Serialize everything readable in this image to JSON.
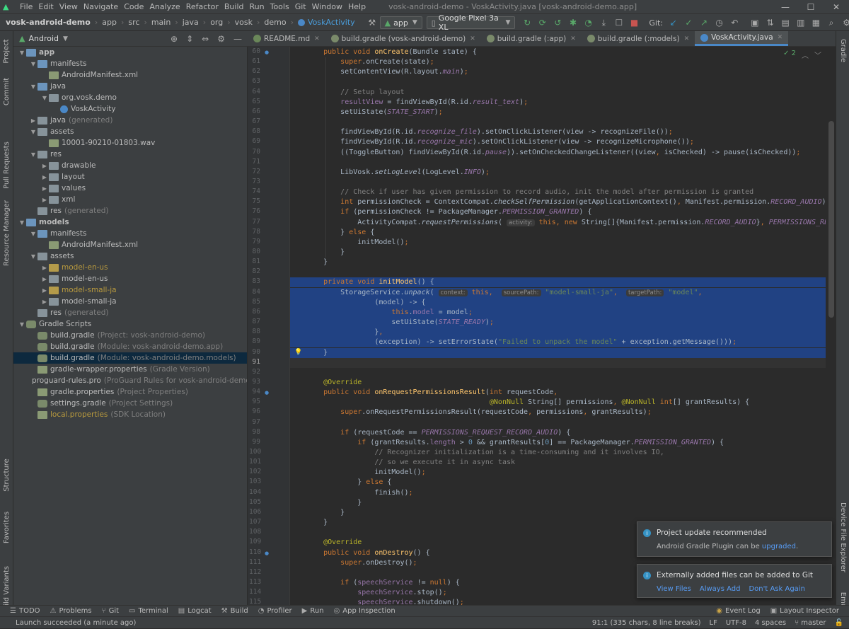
{
  "window": {
    "title": "vosk-android-demo - VoskActivity.java [vosk-android-demo.app]"
  },
  "menu": [
    "File",
    "Edit",
    "View",
    "Navigate",
    "Code",
    "Analyze",
    "Refactor",
    "Build",
    "Run",
    "Tools",
    "Git",
    "Window",
    "Help"
  ],
  "breadcrumb": [
    "vosk-android-demo",
    "app",
    "src",
    "main",
    "java",
    "org",
    "vosk",
    "demo",
    "VoskActivity"
  ],
  "toolbar": {
    "config": "app",
    "device": "Google Pixel 3a XL",
    "git_label": "Git:"
  },
  "project_panel": {
    "view": "Android"
  },
  "tree": [
    {
      "d": 0,
      "a": "▼",
      "icon": "folder-blue",
      "label": "app",
      "sub": ""
    },
    {
      "d": 1,
      "a": "▼",
      "icon": "folder-blue",
      "label": "manifests",
      "sub": ""
    },
    {
      "d": 2,
      "a": "",
      "icon": "file",
      "label": "AndroidManifest.xml",
      "sub": ""
    },
    {
      "d": 1,
      "a": "▼",
      "icon": "folder-blue",
      "label": "java",
      "sub": ""
    },
    {
      "d": 2,
      "a": "▼",
      "icon": "folder",
      "label": "org.vosk.demo",
      "sub": ""
    },
    {
      "d": 3,
      "a": "",
      "icon": "class",
      "label": "VoskActivity",
      "sub": ""
    },
    {
      "d": 1,
      "a": "▶",
      "icon": "folder",
      "label": "java",
      "sub": "(generated)"
    },
    {
      "d": 1,
      "a": "▼",
      "icon": "folder",
      "label": "assets",
      "sub": ""
    },
    {
      "d": 2,
      "a": "",
      "icon": "file",
      "label": "10001-90210-01803.wav",
      "sub": ""
    },
    {
      "d": 1,
      "a": "▼",
      "icon": "folder",
      "label": "res",
      "sub": ""
    },
    {
      "d": 2,
      "a": "▶",
      "icon": "folder",
      "label": "drawable",
      "sub": ""
    },
    {
      "d": 2,
      "a": "▶",
      "icon": "folder",
      "label": "layout",
      "sub": ""
    },
    {
      "d": 2,
      "a": "▶",
      "icon": "folder",
      "label": "values",
      "sub": ""
    },
    {
      "d": 2,
      "a": "▶",
      "icon": "folder",
      "label": "xml",
      "sub": ""
    },
    {
      "d": 1,
      "a": "",
      "icon": "folder",
      "label": "res",
      "sub": "(generated)"
    },
    {
      "d": 0,
      "a": "▼",
      "icon": "folder-blue",
      "label": "models",
      "sub": ""
    },
    {
      "d": 1,
      "a": "▼",
      "icon": "folder-blue",
      "label": "manifests",
      "sub": ""
    },
    {
      "d": 2,
      "a": "",
      "icon": "file",
      "label": "AndroidManifest.xml",
      "sub": ""
    },
    {
      "d": 1,
      "a": "▼",
      "icon": "folder",
      "label": "assets",
      "sub": ""
    },
    {
      "d": 2,
      "a": "▶",
      "icon": "folder-gold",
      "label": "model-en-us",
      "sub": "",
      "gold": true
    },
    {
      "d": 2,
      "a": "▶",
      "icon": "folder",
      "label": "model-en-us",
      "sub": ""
    },
    {
      "d": 2,
      "a": "▶",
      "icon": "folder-gold",
      "label": "model-small-ja",
      "sub": "",
      "gold": true
    },
    {
      "d": 2,
      "a": "▶",
      "icon": "folder",
      "label": "model-small-ja",
      "sub": ""
    },
    {
      "d": 1,
      "a": "",
      "icon": "folder",
      "label": "res",
      "sub": "(generated)"
    },
    {
      "d": 0,
      "a": "▼",
      "icon": "gradle",
      "label": "Gradle Scripts",
      "sub": ""
    },
    {
      "d": 1,
      "a": "",
      "icon": "gradle",
      "label": "build.gradle",
      "sub": "(Project: vosk-android-demo)"
    },
    {
      "d": 1,
      "a": "",
      "icon": "gradle",
      "label": "build.gradle",
      "sub": "(Module: vosk-android-demo.app)"
    },
    {
      "d": 1,
      "a": "",
      "icon": "gradle",
      "label": "build.gradle",
      "sub": "(Module: vosk-android-demo.models)",
      "sel": true
    },
    {
      "d": 1,
      "a": "",
      "icon": "file",
      "label": "gradle-wrapper.properties",
      "sub": "(Gradle Version)"
    },
    {
      "d": 1,
      "a": "",
      "icon": "file",
      "label": "proguard-rules.pro",
      "sub": "(ProGuard Rules for vosk-android-demo.app)"
    },
    {
      "d": 1,
      "a": "",
      "icon": "file",
      "label": "gradle.properties",
      "sub": "(Project Properties)"
    },
    {
      "d": 1,
      "a": "",
      "icon": "gradle",
      "label": "settings.gradle",
      "sub": "(Project Settings)"
    },
    {
      "d": 1,
      "a": "",
      "icon": "file",
      "label": "local.properties",
      "sub": "(SDK Location)",
      "gold": true
    }
  ],
  "tabs": [
    {
      "label": "README.md",
      "icon": "#6a8759",
      "active": false
    },
    {
      "label": "build.gradle (vosk-android-demo)",
      "icon": "#7a8a6a",
      "active": false
    },
    {
      "label": "build.gradle (:app)",
      "icon": "#7a8a6a",
      "active": false
    },
    {
      "label": "build.gradle (:models)",
      "icon": "#7a8a6a",
      "active": false
    },
    {
      "label": "VoskActivity.java",
      "icon": "#4a88c7",
      "active": true
    }
  ],
  "editor": {
    "inspections": "✓ 2"
  },
  "code": [
    {
      "n": "60",
      "h": "    <span class='k'>public void </span><span class='f'>onCreate</span>(Bundle state) {"
    },
    {
      "n": "61",
      "h": "        <span class='k'>super</span>.onCreate(state)<span class='k'>;</span>"
    },
    {
      "n": "62",
      "h": "        setContentView(R.layout.<span class='p'>main</span>)<span class='k'>;</span>"
    },
    {
      "n": "63",
      "h": ""
    },
    {
      "n": "64",
      "h": "        <span class='c'>// Setup layout</span>"
    },
    {
      "n": "65",
      "h": "        <span class='pf'>resultView</span> = findViewById(R.id.<span class='p'>result_text</span>)<span class='k'>;</span>"
    },
    {
      "n": "66",
      "h": "        setUiState(<span class='p'>STATE_START</span>)<span class='k'>;</span>"
    },
    {
      "n": "67",
      "h": ""
    },
    {
      "n": "68",
      "h": "        findViewById(R.id.<span class='p'>recognize_file</span>).setOnClickListener(view -> recognizeFile())<span class='k'>;</span>"
    },
    {
      "n": "69",
      "h": "        findViewById(R.id.<span class='p'>recognize_mic</span>).setOnClickListener(view -> recognizeMicrophone())<span class='k'>;</span>"
    },
    {
      "n": "70",
      "h": "        ((ToggleButton) findViewById(R.id.<span class='p'>pause</span>)).setOnCheckedChangeListener((view<span class='k'>, </span>isChecked) -> pause(isChecked))<span class='k'>;</span>"
    },
    {
      "n": "71",
      "h": ""
    },
    {
      "n": "72",
      "h": "        LibVosk.<span class='it'>setLogLevel</span>(LogLevel.<span class='p'>INFO</span>)<span class='k'>;</span>"
    },
    {
      "n": "73",
      "h": ""
    },
    {
      "n": "74",
      "h": "        <span class='c'>// Check if user has given permission to record audio, init the model after permission is granted</span>"
    },
    {
      "n": "75",
      "h": "        <span class='k'>int </span>permissionCheck = ContextCompat.<span class='it'>checkSelfPermission</span>(getApplicationContext()<span class='k'>, </span>Manifest.permission.<span class='p'>RECORD_AUDIO</span>)<span class='k'>;</span>"
    },
    {
      "n": "76",
      "h": "        <span class='k'>if </span>(permissionCheck != PackageManager.<span class='p'>PERMISSION_GRANTED</span>) {"
    },
    {
      "n": "77",
      "h": "            ActivityCompat.<span class='it'>requestPermissions</span>( <span class='hint'>activity:</span> <span class='k'>this, new </span>String[]{Manifest.permission.<span class='p'>RECORD_AUDIO</span>}<span class='k'>, </span><span class='p'>PERMISSIONS_REQUEST_RECORD_AUDIO</span>)<span class='k'>;</span>"
    },
    {
      "n": "78",
      "h": "        } <span class='k'>else </span>{"
    },
    {
      "n": "79",
      "h": "            initModel()<span class='k'>;</span>"
    },
    {
      "n": "80",
      "h": "        }"
    },
    {
      "n": "81",
      "h": "    }"
    },
    {
      "n": "82",
      "h": ""
    },
    {
      "n": "83",
      "h": "    <span class='k'>private void </span><span class='f'>initModel</span>() {",
      "hl": true
    },
    {
      "n": "84",
      "h": "        StorageService.<span class='it'>unpack</span>( <span class='hint'>context:</span> <span class='k'>this, </span> <span class='hint'>sourcePath:</span> <span class='s'>\"model-small-ja\"</span><span class='k'>, </span> <span class='hint'>targetPath:</span> <span class='s'>\"model\"</span><span class='k'>,</span>",
      "hl": true
    },
    {
      "n": "85",
      "h": "                (model) -> {",
      "hl": true
    },
    {
      "n": "86",
      "h": "                    <span class='k'>this</span>.<span class='pf'>model</span> = model<span class='k'>;</span>",
      "hl": true
    },
    {
      "n": "87",
      "h": "                    setUiState(<span class='p'>STATE_READY</span>)<span class='k'>;</span>",
      "hl": true
    },
    {
      "n": "88",
      "h": "                }<span class='k'>,</span>",
      "hl": true
    },
    {
      "n": "89",
      "h": "                (exception) -> setErrorState(<span class='s'>\"Failed to unpack the model\"</span> + exception.getMessage()))<span class='k'>;</span>",
      "hl": true
    },
    {
      "n": "90",
      "h": "    }",
      "hl": true
    },
    {
      "n": "91",
      "h": "",
      "cur": true
    },
    {
      "n": "92",
      "h": ""
    },
    {
      "n": "93",
      "h": "    <span class='an'>@Override</span>"
    },
    {
      "n": "94",
      "h": "    <span class='k'>public void </span><span class='f'>onRequestPermissionsResult</span>(<span class='k'>int </span>requestCode<span class='k'>,</span>"
    },
    {
      "n": "95",
      "h": "                                           <span class='an'>@NonNull </span>String[] permissions<span class='k'>, </span><span class='an'>@NonNull </span><span class='k'>int</span>[] grantResults) {"
    },
    {
      "n": "96",
      "h": "        <span class='k'>super</span>.onRequestPermissionsResult(requestCode<span class='k'>, </span>permissions<span class='k'>, </span>grantResults)<span class='k'>;</span>"
    },
    {
      "n": "97",
      "h": ""
    },
    {
      "n": "98",
      "h": "        <span class='k'>if </span>(requestCode == <span class='p'>PERMISSIONS_REQUEST_RECORD_AUDIO</span>) {"
    },
    {
      "n": "99",
      "h": "            <span class='k'>if </span>(grantResults.<span class='pf'>length </span>> <span style='color:#6897bb'>0 </span>&amp;&amp; grantResults[<span style='color:#6897bb'>0</span>] == PackageManager.<span class='p'>PERMISSION_GRANTED</span>) {"
    },
    {
      "n": "100",
      "h": "                <span class='c'>// Recognizer initialization is a time-consuming and it involves IO,</span>"
    },
    {
      "n": "101",
      "h": "                <span class='c'>// so we execute it in async task</span>"
    },
    {
      "n": "102",
      "h": "                initModel()<span class='k'>;</span>"
    },
    {
      "n": "103",
      "h": "            } <span class='k'>else </span>{"
    },
    {
      "n": "104",
      "h": "                finish()<span class='k'>;</span>"
    },
    {
      "n": "105",
      "h": "            }"
    },
    {
      "n": "106",
      "h": "        }"
    },
    {
      "n": "107",
      "h": "    }"
    },
    {
      "n": "108",
      "h": ""
    },
    {
      "n": "109",
      "h": "    <span class='an'>@Override</span>"
    },
    {
      "n": "110",
      "h": "    <span class='k'>public void </span><span class='f'>onDestroy</span>() {"
    },
    {
      "n": "111",
      "h": "        <span class='k'>super</span>.onDestroy()<span class='k'>;</span>"
    },
    {
      "n": "112",
      "h": ""
    },
    {
      "n": "113",
      "h": "        <span class='k'>if </span>(<span class='pf'>speechService </span>!= <span class='k'>null</span>) {"
    },
    {
      "n": "114",
      "h": "            <span class='pf'>speechService</span>.stop()<span class='k'>;</span>"
    },
    {
      "n": "115",
      "h": "            <span class='pf'>speechService</span>.shutdown()<span class='k'>;</span>"
    }
  ],
  "notifications": {
    "n1": {
      "title": "Project update recommended",
      "body": "Android Gradle Plugin can be",
      "link": "upgraded",
      "tail": "."
    },
    "n2": {
      "title": "Externally added files can be added to Git",
      "a1": "View Files",
      "a2": "Always Add",
      "a3": "Don't Ask Again"
    }
  },
  "left_tabs": [
    "Project",
    "Commit",
    "Pull Requests",
    "Resource Manager",
    "Structure",
    "Favorites",
    "Build Variants"
  ],
  "right_tabs": [
    "Gradle",
    "Device File Explorer",
    "Emulator"
  ],
  "bottom_tools": [
    "TODO",
    "Problems",
    "Git",
    "Terminal",
    "Logcat",
    "Build",
    "Profiler",
    "Run",
    "App Inspection"
  ],
  "bottom_right": [
    "Event Log",
    "Layout Inspector"
  ],
  "status": {
    "message": "Launch succeeded (a minute ago)",
    "position": "91:1 (335 chars, 8 line breaks)",
    "line_sep": "LF",
    "encoding": "UTF-8",
    "indent": "4 spaces",
    "branch": "master"
  }
}
